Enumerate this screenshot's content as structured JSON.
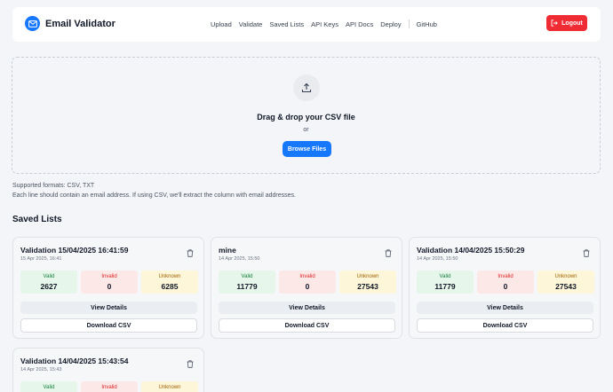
{
  "app": {
    "title": "Email Validator"
  },
  "nav": {
    "links": [
      "Upload",
      "Validate",
      "Saved Lists",
      "API Keys",
      "API Docs",
      "Deploy"
    ],
    "github": "GitHub",
    "logout": "Logout"
  },
  "upload": {
    "title": "Drag & drop your CSV file",
    "or": "or",
    "browse": "Browse Files",
    "formats": "Supported formats: CSV, TXT",
    "hint": "Each line should contain an email address. If using CSV, we'll extract the column with email addresses."
  },
  "saved": {
    "title": "Saved Lists",
    "labels": {
      "valid": "Valid",
      "invalid": "Invalid",
      "unknown": "Unknown",
      "view": "View Details",
      "download": "Download CSV"
    },
    "cards": [
      {
        "name": "Validation 15/04/2025 16:41:59",
        "date": "15 Apr 2025, 16:41",
        "valid": "2627",
        "invalid": "0",
        "unknown": "6285"
      },
      {
        "name": "mine",
        "date": "14 Apr 2025, 15:50",
        "valid": "11779",
        "invalid": "0",
        "unknown": "27543"
      },
      {
        "name": "Validation 14/04/2025 15:50:29",
        "date": "14 Apr 2025, 15:50",
        "valid": "11779",
        "invalid": "0",
        "unknown": "27543"
      },
      {
        "name": "Validation 14/04/2025 15:43:54",
        "date": "14 Apr 2025, 15:43"
      }
    ]
  },
  "colors": {
    "primary": "#1677ff",
    "danger": "#ef2b34",
    "valid_bg": "#e6f6ea",
    "invalid_bg": "#fde8e8",
    "unknown_bg": "#fdf6d8"
  }
}
